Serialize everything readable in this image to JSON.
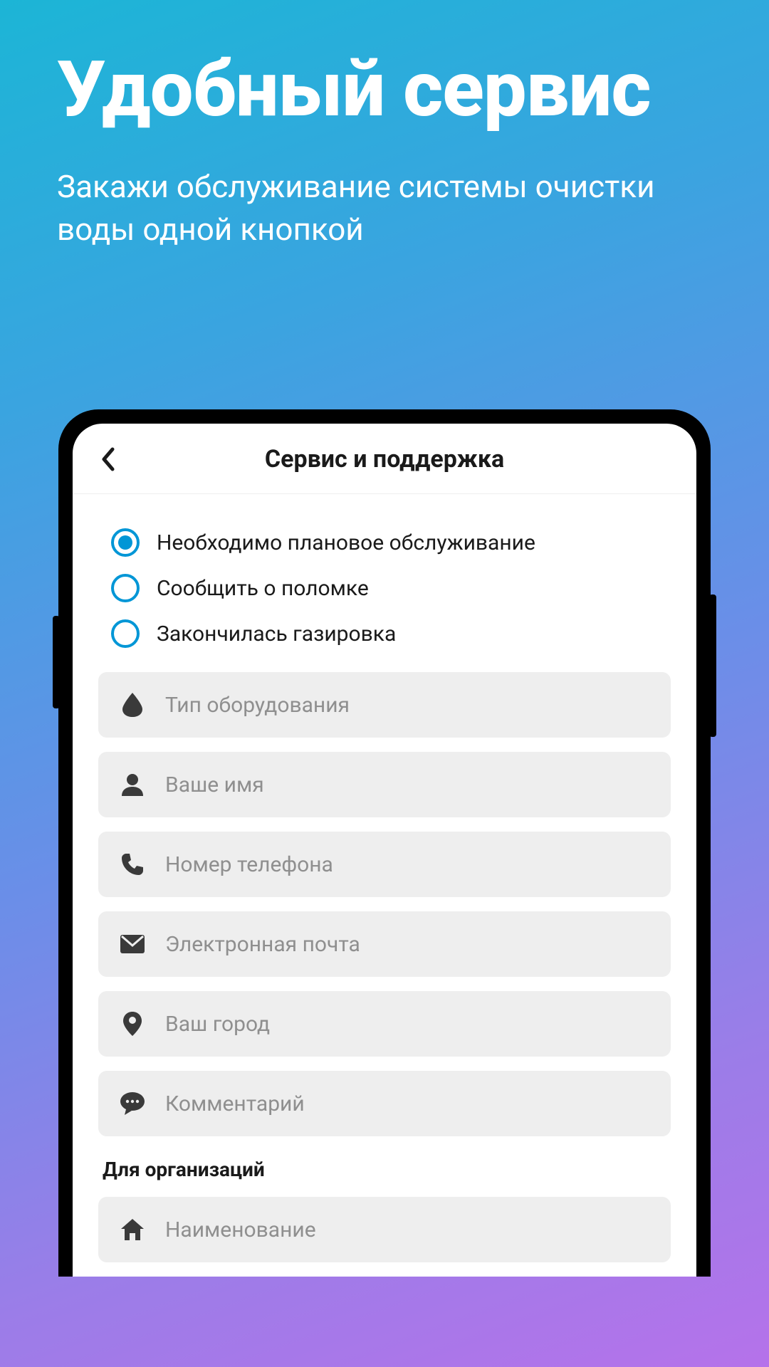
{
  "hero": {
    "title": "Удобный сервис",
    "subtitle": "Закажи обслуживание системы очистки воды одной кнопкой"
  },
  "app": {
    "header_title": "Сервис и поддержка",
    "radios": [
      {
        "label": "Необходимо плановое обслуживание",
        "selected": true
      },
      {
        "label": "Сообщить о поломке",
        "selected": false
      },
      {
        "label": "Закончилась газировка",
        "selected": false
      }
    ],
    "fields": {
      "equipment_type": "Тип оборудования",
      "name": "Ваше имя",
      "phone": "Номер телефона",
      "email": "Электронная почта",
      "city": "Ваш город",
      "comment": "Комментарий",
      "org_name": "Наименование"
    },
    "section_org": "Для организаций"
  }
}
